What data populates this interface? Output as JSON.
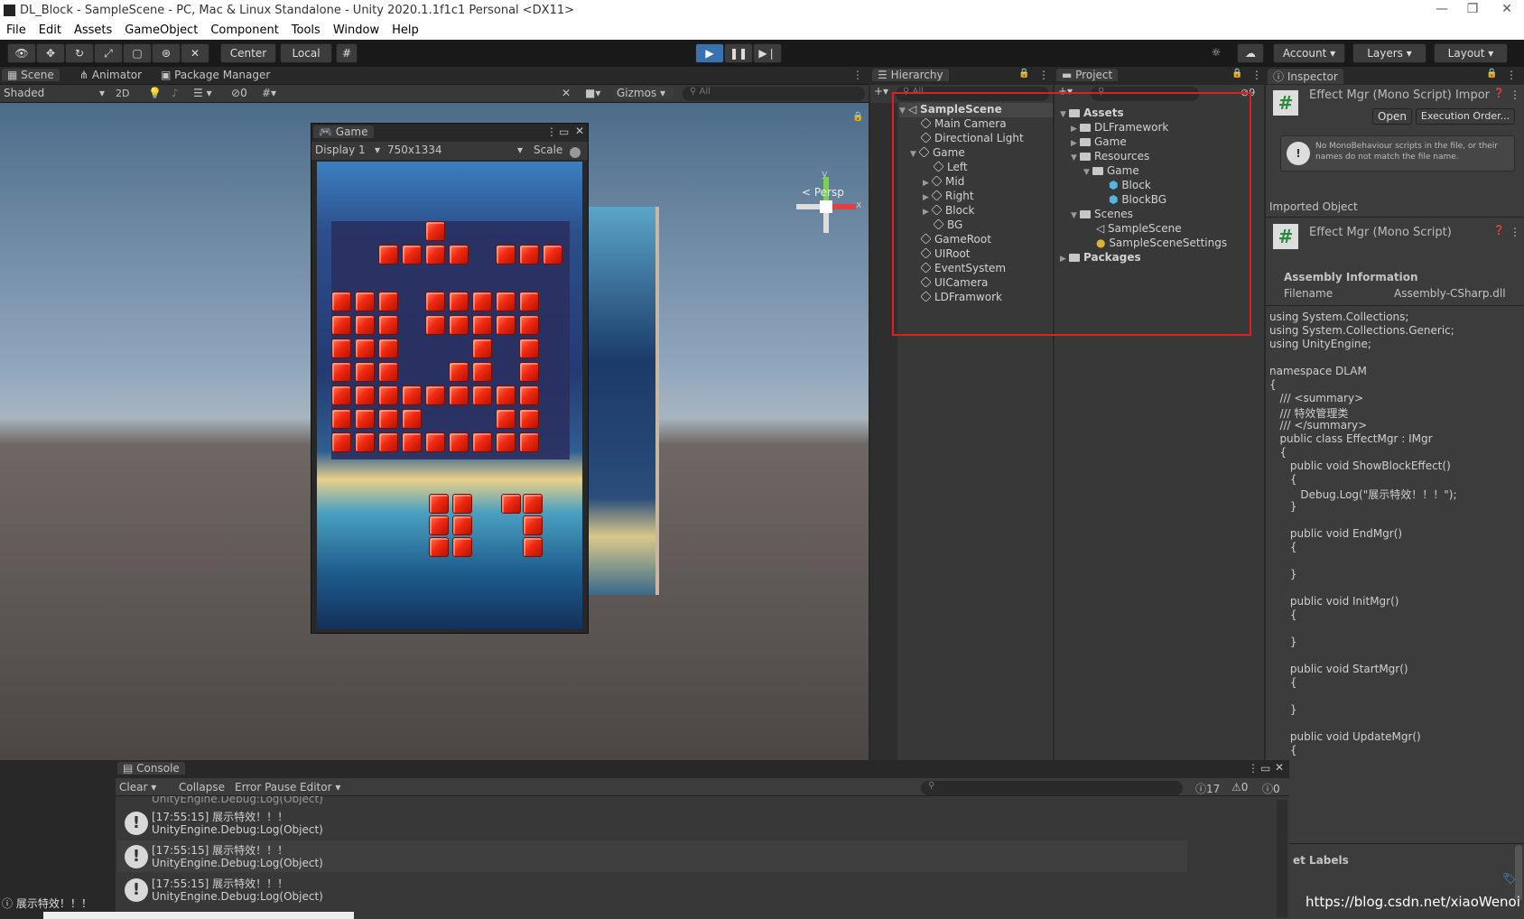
{
  "window": {
    "title": "DL_Block - SampleScene - PC, Mac & Linux Standalone - Unity 2020.1.1f1c1 Personal <DX11>",
    "minimize": "—",
    "maximize": "❐",
    "close": "✕"
  },
  "menu": [
    "File",
    "Edit",
    "Assets",
    "GameObject",
    "Component",
    "Tools",
    "Window",
    "Help"
  ],
  "toolbar": {
    "center": "Center",
    "local": "Local",
    "account": "Account",
    "layers": "Layers",
    "layout": "Layout"
  },
  "scene_tabs": {
    "scene": "Scene",
    "animator": "Animator",
    "package_manager": "Package Manager",
    "shaded": "Shaded",
    "two_d": "2D",
    "gizmos": "Gizmos",
    "search_placeholder": "All",
    "hidden_count": "0",
    "persp": "< Persp",
    "axis_y": "y",
    "axis_x": "x"
  },
  "game_view": {
    "tab": "Game",
    "display": "Display 1",
    "resolution": "750x1334",
    "scale": "Scale"
  },
  "hierarchy": {
    "title": "Hierarchy",
    "search_placeholder": "All",
    "items": [
      {
        "label": "SampleScene"
      },
      {
        "label": "Main Camera"
      },
      {
        "label": "Directional Light"
      },
      {
        "label": "Game"
      },
      {
        "label": "Left"
      },
      {
        "label": "Mid"
      },
      {
        "label": "Right"
      },
      {
        "label": "Block"
      },
      {
        "label": "BG"
      },
      {
        "label": "GameRoot"
      },
      {
        "label": "UIRoot"
      },
      {
        "label": "EventSystem"
      },
      {
        "label": "UICamera"
      },
      {
        "label": "LDFramwork"
      }
    ]
  },
  "project": {
    "title": "Project",
    "hidden_count": "9",
    "items": [
      {
        "label": "Assets"
      },
      {
        "label": "DLFramework"
      },
      {
        "label": "Game"
      },
      {
        "label": "Resources"
      },
      {
        "label": "Game"
      },
      {
        "label": "Block"
      },
      {
        "label": "BlockBG"
      },
      {
        "label": "Scenes"
      },
      {
        "label": "SampleScene"
      },
      {
        "label": "SampleSceneSettings"
      },
      {
        "label": "Packages"
      }
    ]
  },
  "inspector": {
    "title": "Inspector",
    "header": "Effect Mgr (Mono Script) Impor",
    "open": "Open",
    "exec_order": "Execution Order...",
    "warning": "No MonoBehaviour scripts in the file, or their names do not match the file name.",
    "imported": "Imported Object",
    "imported_name": "Effect Mgr (Mono Script)",
    "assembly_info": "Assembly Information",
    "filename_label": "Filename",
    "filename_value": "Assembly-CSharp.dll",
    "asset_labels": "et Labels",
    "code": [
      "using System.Collections;",
      "using System.Collections.Generic;",
      "using UnityEngine;",
      "",
      "namespace DLAM",
      "{",
      "   /// <summary>",
      "   /// 特效管理类",
      "   /// </summary>",
      "   public class EffectMgr : IMgr",
      "   {",
      "      public void ShowBlockEffect()",
      "      {",
      "         Debug.Log(\"展示特效！！！\");",
      "      }",
      "",
      "      public void EndMgr()",
      "      {",
      "",
      "      }",
      "",
      "      public void InitMgr()",
      "      {",
      "",
      "      }",
      "",
      "      public void StartMgr()",
      "      {",
      "",
      "      }",
      "",
      "      public void UpdateMgr()",
      "      {"
    ]
  },
  "console": {
    "title": "Console",
    "clear": "Clear",
    "collapse": "Collapse",
    "error_pause": "Error Pause",
    "editor": "Editor",
    "log_count": "17",
    "warn_count": "0",
    "error_count": "0",
    "partial": "UnityEngine.Debug:Log(Object)",
    "rows": [
      {
        "msg": "[17:55:15] 展示特效！！！",
        "trace": "UnityEngine.Debug:Log(Object)"
      },
      {
        "msg": "[17:55:15] 展示特效！！！",
        "trace": "UnityEngine.Debug:Log(Object)"
      },
      {
        "msg": "[17:55:15] 展示特效！！！",
        "trace": "UnityEngine.Debug:Log(Object)"
      }
    ]
  },
  "status": {
    "text": "展示特效！！！",
    "watermark": "https://blog.csdn.net/xiaoWenoi"
  },
  "colors": {
    "highlight": "#e02020",
    "accent": "#3a72b0"
  }
}
